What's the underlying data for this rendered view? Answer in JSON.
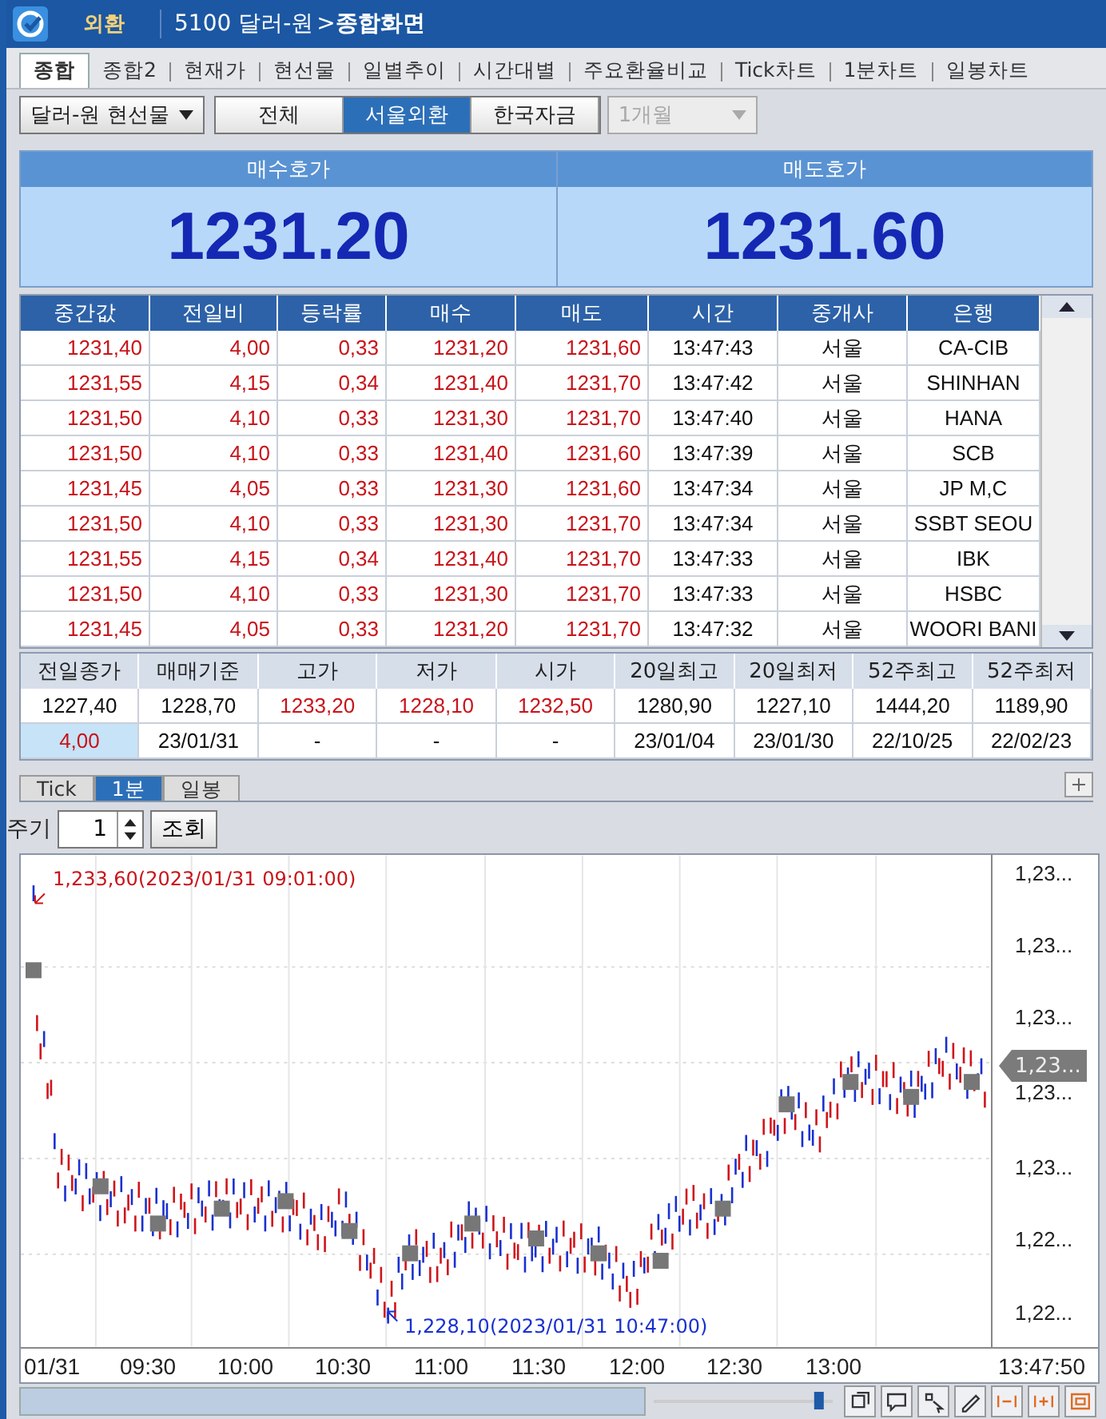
{
  "title_bar": {
    "badge": "외환",
    "code": "5100 달러-원",
    "arrow": ">",
    "title": "종합화면"
  },
  "tabs": [
    {
      "label": "종합",
      "selected": true
    },
    {
      "label": "종합2",
      "selected": false
    },
    {
      "label": "현재가",
      "selected": false
    },
    {
      "label": "현선물",
      "selected": false
    },
    {
      "label": "일별추이",
      "selected": false
    },
    {
      "label": "시간대별",
      "selected": false
    },
    {
      "label": "주요환율비교",
      "selected": false
    },
    {
      "label": "Tick차트",
      "selected": false
    },
    {
      "label": "1분차트",
      "selected": false
    },
    {
      "label": "일봉차트",
      "selected": false
    }
  ],
  "filters": {
    "product": "달러-원 현선물",
    "segments": [
      {
        "label": "전체",
        "selected": false
      },
      {
        "label": "서울외환",
        "selected": true
      },
      {
        "label": "한국자금",
        "selected": false
      }
    ],
    "term": {
      "value": "1개월",
      "disabled": true
    }
  },
  "quote": [
    {
      "label": "매수호가",
      "price": "1231.20"
    },
    {
      "label": "매도호가",
      "price": "1231.60"
    }
  ],
  "trades": {
    "columns": [
      {
        "label": "중간값",
        "kind": "up"
      },
      {
        "label": "전일비",
        "kind": "up"
      },
      {
        "label": "등락률",
        "kind": "up"
      },
      {
        "label": "매수",
        "kind": "up"
      },
      {
        "label": "매도",
        "kind": "up"
      },
      {
        "label": "시간",
        "kind": "plain"
      },
      {
        "label": "중개사",
        "kind": "plain"
      },
      {
        "label": "은행",
        "kind": "plain"
      }
    ],
    "rows": [
      [
        "1231,40",
        "4,00",
        "0,33",
        "1231,20",
        "1231,60",
        "13:47:43",
        "서울",
        "CA-CIB"
      ],
      [
        "1231,55",
        "4,15",
        "0,34",
        "1231,40",
        "1231,70",
        "13:47:42",
        "서울",
        "SHINHAN"
      ],
      [
        "1231,50",
        "4,10",
        "0,33",
        "1231,30",
        "1231,70",
        "13:47:40",
        "서울",
        "HANA"
      ],
      [
        "1231,50",
        "4,10",
        "0,33",
        "1231,40",
        "1231,60",
        "13:47:39",
        "서울",
        "SCB"
      ],
      [
        "1231,45",
        "4,05",
        "0,33",
        "1231,30",
        "1231,60",
        "13:47:34",
        "서울",
        "JP M,C"
      ],
      [
        "1231,50",
        "4,10",
        "0,33",
        "1231,30",
        "1231,70",
        "13:47:34",
        "서울",
        "SSBT SEOU"
      ],
      [
        "1231,55",
        "4,15",
        "0,34",
        "1231,40",
        "1231,70",
        "13:47:33",
        "서울",
        "IBK"
      ],
      [
        "1231,50",
        "4,10",
        "0,33",
        "1231,30",
        "1231,70",
        "13:47:33",
        "서울",
        "HSBC"
      ],
      [
        "1231,45",
        "4,05",
        "0,33",
        "1231,20",
        "1231,70",
        "13:47:32",
        "서울",
        "WOORI BANI"
      ]
    ]
  },
  "summary": {
    "columns": [
      "전일종가",
      "매매기준",
      "고가",
      "저가",
      "시가",
      "20일최고",
      "20일최저",
      "52주최고",
      "52주최저"
    ],
    "rows": [
      [
        {
          "text": "1227,40",
          "kind": "plain"
        },
        {
          "text": "1228,70",
          "kind": "plain"
        },
        {
          "text": "1233,20",
          "kind": "up"
        },
        {
          "text": "1228,10",
          "kind": "up"
        },
        {
          "text": "1232,50",
          "kind": "up"
        },
        {
          "text": "1280,90",
          "kind": "plain"
        },
        {
          "text": "1227,10",
          "kind": "plain"
        },
        {
          "text": "1444,20",
          "kind": "plain"
        },
        {
          "text": "1189,90",
          "kind": "plain"
        }
      ],
      [
        {
          "text": "4,00",
          "kind": "change"
        },
        {
          "text": "23/01/31",
          "kind": "plain"
        },
        {
          "text": "-",
          "kind": "plain"
        },
        {
          "text": "-",
          "kind": "plain"
        },
        {
          "text": "-",
          "kind": "plain"
        },
        {
          "text": "23/01/04",
          "kind": "plain"
        },
        {
          "text": "23/01/30",
          "kind": "plain"
        },
        {
          "text": "22/10/25",
          "kind": "plain"
        },
        {
          "text": "22/02/23",
          "kind": "plain"
        }
      ]
    ]
  },
  "chart_tabs": [
    {
      "label": "Tick",
      "selected": false
    },
    {
      "label": "1분",
      "selected": true
    },
    {
      "label": "일봉",
      "selected": false
    }
  ],
  "period": {
    "label": "주기",
    "value": "1",
    "button": "조회"
  },
  "chart": {
    "zoom": {
      "level": 0.95
    },
    "high_note": "1,233,60(2023/01/31 09:01:00)",
    "low_note": "1,228,10(2023/01/31 10:47:00)",
    "y_labels": [
      "1,23...",
      "1,23...",
      "1,23...",
      "1,23...",
      "1,23...",
      "1,22...",
      "1,22..."
    ],
    "current": "1,23...",
    "x_labels": [
      "01/31",
      "09:30",
      "10:00",
      "10:30",
      "11:00",
      "11:30",
      "12:00",
      "12:30",
      "13:00",
      "13:47:50"
    ]
  }
}
